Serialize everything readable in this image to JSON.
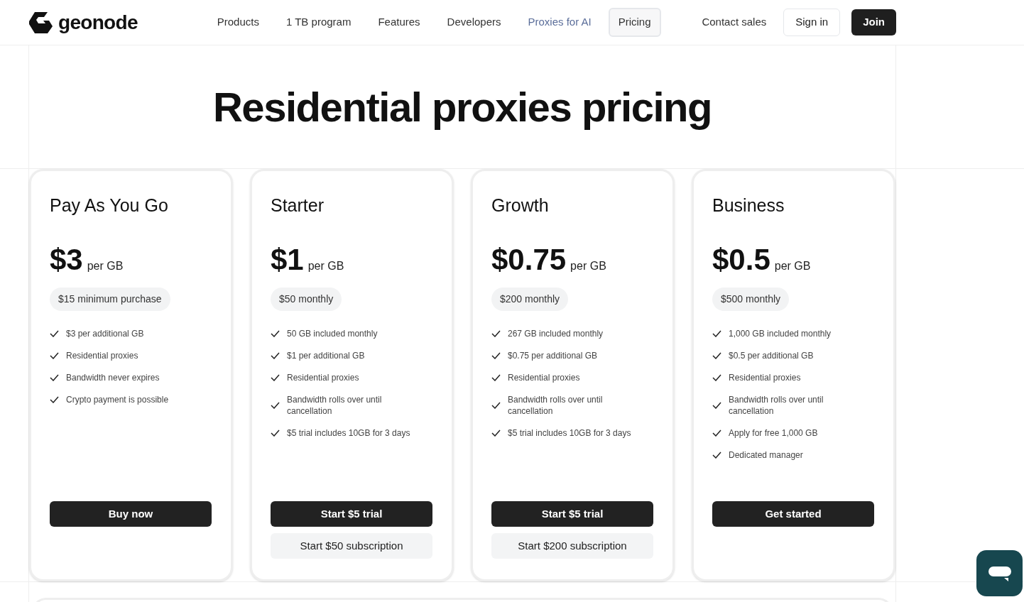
{
  "header": {
    "logo": "geonode",
    "nav": [
      {
        "label": "Products",
        "selected": false,
        "highlighted": false
      },
      {
        "label": "1 TB program",
        "selected": false,
        "highlighted": false
      },
      {
        "label": "Features",
        "selected": false,
        "highlighted": false
      },
      {
        "label": "Developers",
        "selected": false,
        "highlighted": false
      },
      {
        "label": "Proxies for AI",
        "selected": false,
        "highlighted": true
      },
      {
        "label": "Pricing",
        "selected": true,
        "highlighted": false
      }
    ],
    "actions": [
      {
        "label": "Contact sales",
        "kind": "link"
      },
      {
        "label": "Sign in",
        "kind": "outline"
      },
      {
        "label": "Join",
        "kind": "primary"
      }
    ]
  },
  "title": "Residential proxies pricing",
  "plans": [
    {
      "name": "Pay As You Go",
      "price": "$3",
      "unit": "per GB",
      "note": "$15 minimum purchase",
      "features": [
        "$3 per additional GB",
        "Residential proxies",
        "Bandwidth never expires",
        "Crypto payment is possible"
      ],
      "buttons": [
        {
          "label": "Buy now",
          "kind": "primary"
        }
      ]
    },
    {
      "name": "Starter",
      "price": "$1",
      "unit": "per GB",
      "note": "$50 monthly",
      "features": [
        "50 GB included monthly",
        "$1 per additional GB",
        "Residential proxies",
        "Bandwidth rolls over until cancellation",
        "$5 trial includes 10GB for 3 days"
      ],
      "buttons": [
        {
          "label": "Start $5 trial",
          "kind": "primary"
        },
        {
          "label": "Start $50 subscription",
          "kind": "secondary"
        }
      ]
    },
    {
      "name": "Growth",
      "price": "$0.75",
      "unit": "per GB",
      "note": "$200 monthly",
      "features": [
        "267 GB included monthly",
        "$0.75 per additional GB",
        "Residential proxies",
        "Bandwidth rolls over until cancellation",
        "$5 trial includes 10GB for 3 days"
      ],
      "buttons": [
        {
          "label": "Start $5 trial",
          "kind": "primary"
        },
        {
          "label": "Start $200 subscription",
          "kind": "secondary"
        }
      ]
    },
    {
      "name": "Business",
      "price": "$0.5",
      "unit": "per GB",
      "note": "$500 monthly",
      "features": [
        "1,000 GB included monthly",
        "$0.5 per additional GB",
        "Residential proxies",
        "Bandwidth rolls over until cancellation",
        "Apply for free 1,000 GB",
        "Dedicated manager"
      ],
      "buttons": [
        {
          "label": "Get started",
          "kind": "primary"
        }
      ]
    }
  ]
}
